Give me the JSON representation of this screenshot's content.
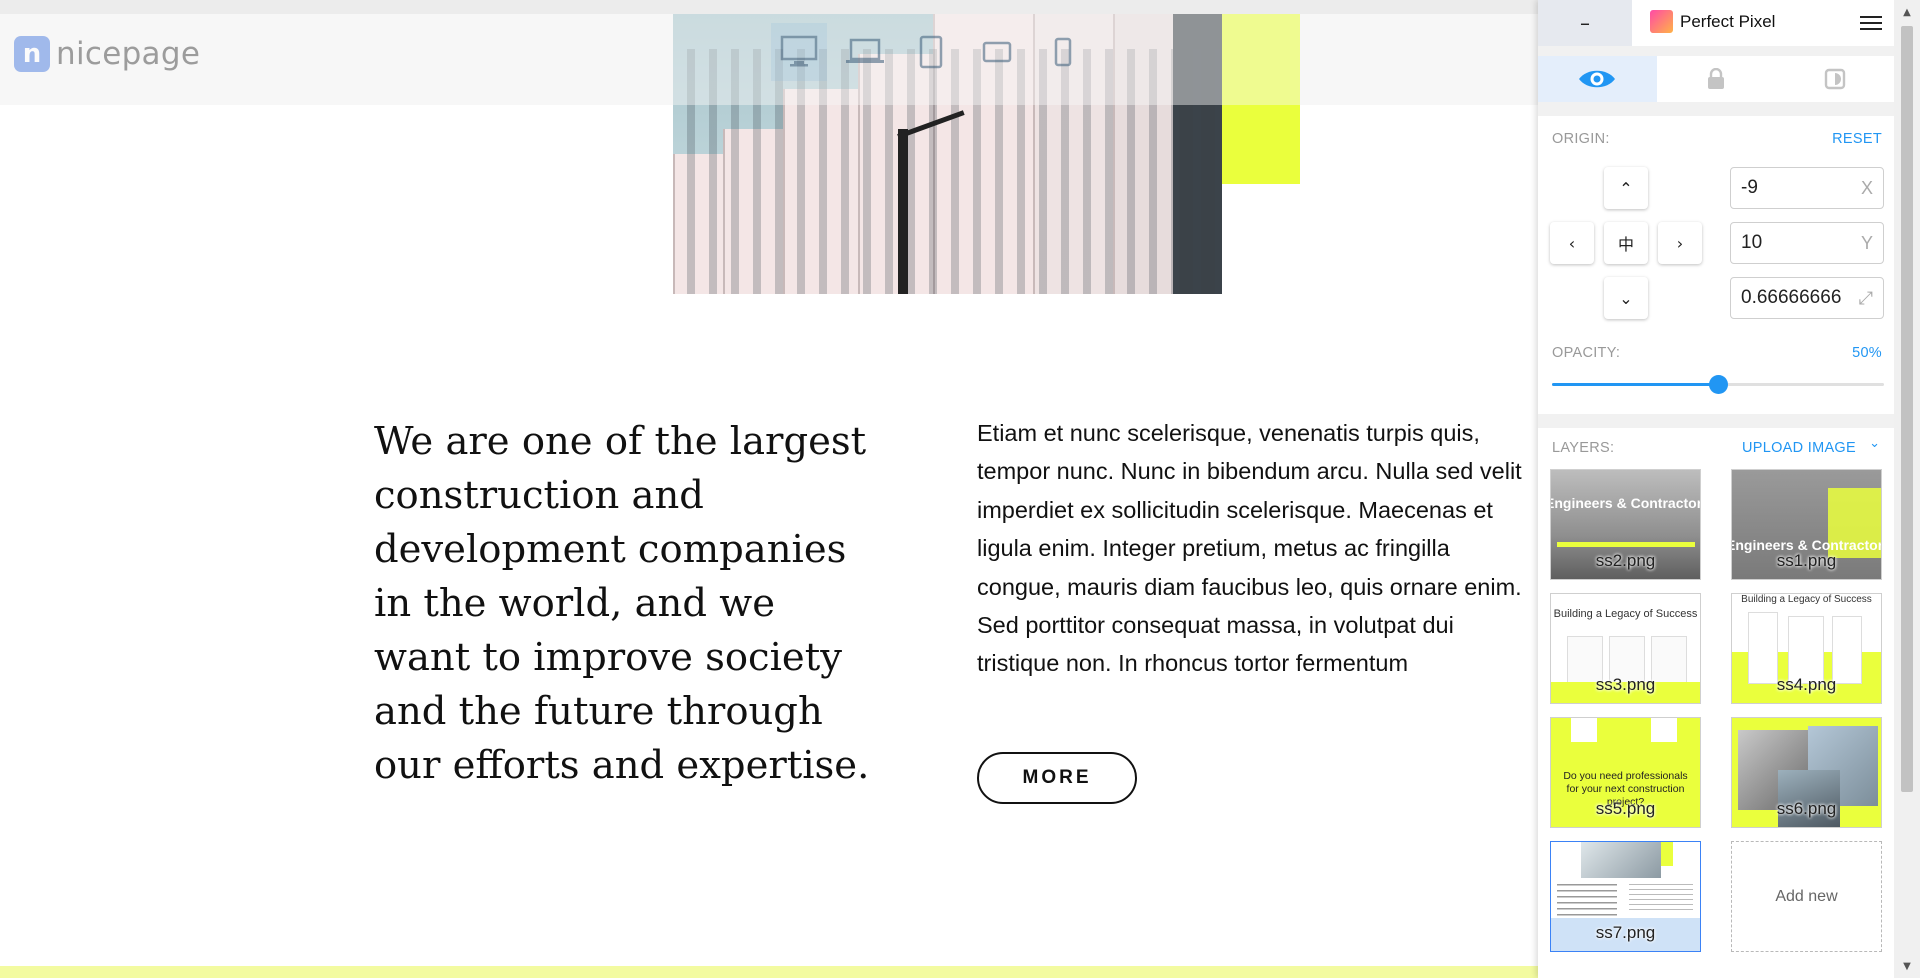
{
  "brand": {
    "logo_letter": "n",
    "logo_text": "nicepage"
  },
  "devices": [
    "desktop-icon",
    "laptop-icon",
    "tablet-icon",
    "tablet-landscape-icon",
    "phone-icon"
  ],
  "content": {
    "heading": "We are one of the largest construction and development companies in the world, and we want to improve society and the future through our efforts and expertise.",
    "body": "Etiam et nunc scelerisque, venenatis turpis quis, tempor nunc. Nunc in bibendum arcu. Nulla sed velit imperdiet ex sollicitudin scelerisque. Maecenas et ligula enim. Integer pretium, metus ac fringilla congue, mauris diam faucibus leo, quis ornare enim. Sed porttitor consequat massa, in volutpat dui tristique non. In rhoncus tortor fermentum",
    "more_label": "MORE"
  },
  "colors": {
    "accent_yellow": "#eaff3d",
    "panel_blue": "#2196f3"
  },
  "panel": {
    "minimize_label": "–",
    "title": "Perfect Pixel",
    "tabs": [
      "eye-icon",
      "lock-icon",
      "contrast-icon"
    ],
    "origin": {
      "label": "ORIGIN:",
      "reset_label": "RESET",
      "center_glyph": "中",
      "x_value": "-9",
      "x_suffix": "X",
      "y_value": "10",
      "y_suffix": "Y",
      "scale_value": "0.66666666",
      "scale_suffix": "⤢"
    },
    "opacity": {
      "label": "OPACITY:",
      "value_text": "50%",
      "fraction": 0.5
    },
    "layers": {
      "label": "LAYERS:",
      "upload_label": "UPLOAD IMAGE",
      "items": [
        {
          "file": "ss2.png",
          "preview_text": "Engineers & Contractors"
        },
        {
          "file": "ss1.png",
          "preview_text": "Engineers & Contractors"
        },
        {
          "file": "ss3.png",
          "preview_text": "Building a Legacy of Success"
        },
        {
          "file": "ss4.png",
          "preview_text": "Building a Legacy of Success"
        },
        {
          "file": "ss5.png",
          "preview_text": "Do you need professionals for your next construction project?"
        },
        {
          "file": "ss6.png",
          "preview_text": ""
        },
        {
          "file": "ss7.png",
          "preview_text": ""
        }
      ],
      "add_new_label": "Add new"
    }
  }
}
